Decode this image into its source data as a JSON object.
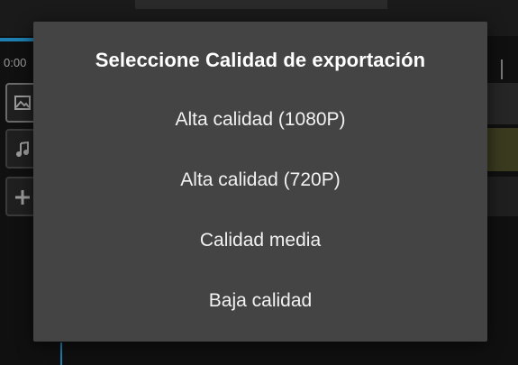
{
  "background": {
    "time_label": "0:00"
  },
  "dialog": {
    "title": "Seleccione Calidad de exportación",
    "options": [
      {
        "label": "Alta calidad (1080P)"
      },
      {
        "label": "Alta calidad (720P)"
      },
      {
        "label": "Calidad media"
      },
      {
        "label": "Baja calidad"
      }
    ]
  },
  "icons": {
    "image": "image-icon",
    "music": "music-note-icon",
    "add": "plus-icon"
  }
}
